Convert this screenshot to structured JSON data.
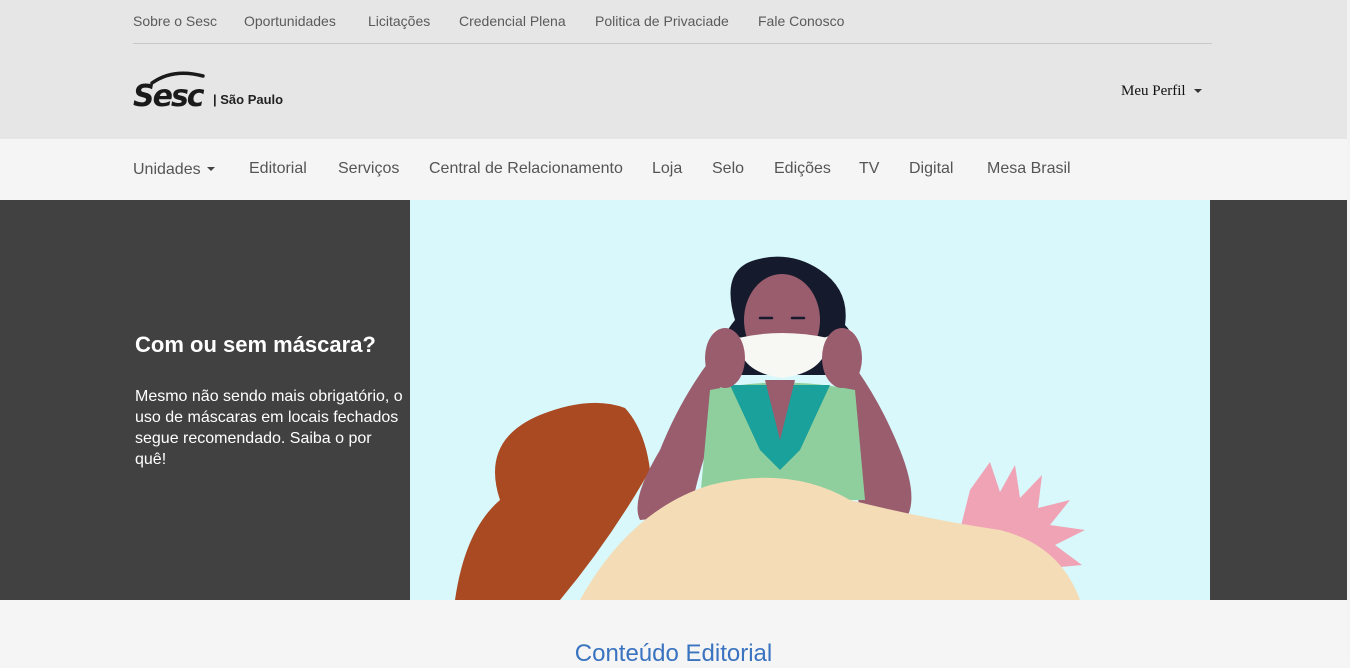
{
  "utility_nav": [
    "Sobre o Sesc",
    "Oportunidades",
    "Licitações",
    "Credencial Plena",
    "Politica de Privaciade",
    "Fale Conosco"
  ],
  "brand": {
    "wordmark": "Sesc",
    "region": "| São Paulo"
  },
  "profile": {
    "label": "Meu Perfil",
    "icon": "caret-down-icon"
  },
  "main_nav": {
    "dropdown_label": "Unidades",
    "items": [
      "Editorial",
      "Serviços",
      "Central de Relacionamento",
      "Loja",
      "Selo",
      "Edições",
      "TV",
      "Digital",
      "Mesa Brasil"
    ]
  },
  "hero": {
    "title": "Com ou sem máscara?",
    "text": "Mesmo não sendo mais obrigatório, o uso de máscaras em locais fechados segue recomendado. Saiba o por quê!",
    "image": "woman-putting-on-face-mask-illustration"
  },
  "section": {
    "title": "Conteúdo Editorial"
  },
  "colors": {
    "header_bg": "#e6e6e6",
    "nav_bg": "#f5f5f5",
    "hero_panel": "#414141",
    "hero_art_bg": "#d8f8fb",
    "section_title": "#3a73c0"
  }
}
